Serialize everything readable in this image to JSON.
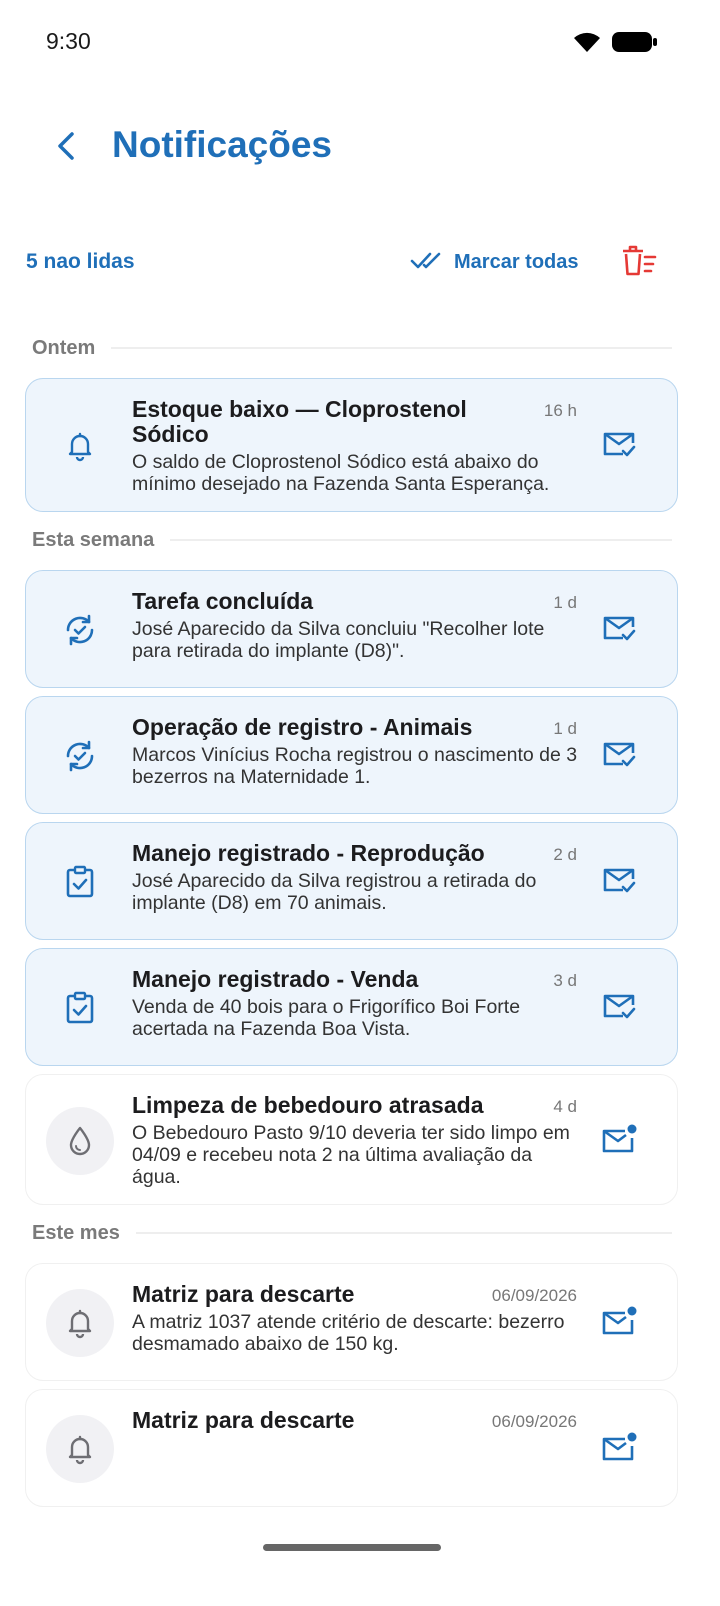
{
  "status_bar": {
    "time": "9:30"
  },
  "header": {
    "title": "Notificações"
  },
  "actions": {
    "unread_count": "5 nao lidas",
    "mark_all_label": "Marcar todas"
  },
  "sections": [
    {
      "title": "Ontem",
      "items": [
        {
          "icon": "bell-icon",
          "title": "Estoque baixo — Cloprostenol Sódico",
          "time": "16 h",
          "body": "O saldo de Cloprostenol Sódico está abaixo do mínimo desejado na Fazenda Santa Esperança.",
          "unread": true
        }
      ]
    },
    {
      "title": "Esta semana",
      "items": [
        {
          "icon": "sync-check-icon",
          "title": "Tarefa concluída",
          "time": "1 d",
          "body": "José Aparecido da Silva concluiu \"Recolher lote para retirada do implante (D8)\".",
          "unread": true
        },
        {
          "icon": "sync-check-icon",
          "title": "Operação de registro - Animais",
          "time": "1 d",
          "body": "Marcos Vinícius Rocha registrou o nascimento de 3 bezerros na Maternidade 1.",
          "unread": true
        },
        {
          "icon": "clipboard-check-icon",
          "title": "Manejo registrado - Reprodução",
          "time": "2 d",
          "body": "José Aparecido da Silva registrou a retirada do implante (D8) em 70 animais.",
          "unread": true
        },
        {
          "icon": "clipboard-check-icon",
          "title": "Manejo registrado - Venda",
          "time": "3 d",
          "body": "Venda de 40 bois para o Frigorífico Boi Forte acertada na Fazenda Boa Vista.",
          "unread": true
        },
        {
          "icon": "water-drop-icon",
          "title": "Limpeza de bebedouro atrasada",
          "time": "4 d",
          "body": "O Bebedouro Pasto 9/10 deveria ter sido limpo em 04/09 e recebeu nota 2 na última avaliação da água.",
          "unread": false
        }
      ]
    },
    {
      "title": "Este mes",
      "items": [
        {
          "icon": "bell-icon",
          "title": "Matriz para descarte",
          "time": "06/09/2026",
          "body": "A matriz 1037 atende critério de descarte: bezerro desmamado abaixo de 150 kg.",
          "unread": false
        },
        {
          "icon": "bell-icon",
          "title": "Matriz para descarte",
          "time": "06/09/2026",
          "body": "",
          "unread": false
        }
      ]
    }
  ],
  "colors": {
    "accent": "#1f6fb8",
    "unread_bg": "#eef5fc",
    "unread_border": "#b9d6ef",
    "delete": "#e53935",
    "section_label": "#7a7a7a"
  }
}
